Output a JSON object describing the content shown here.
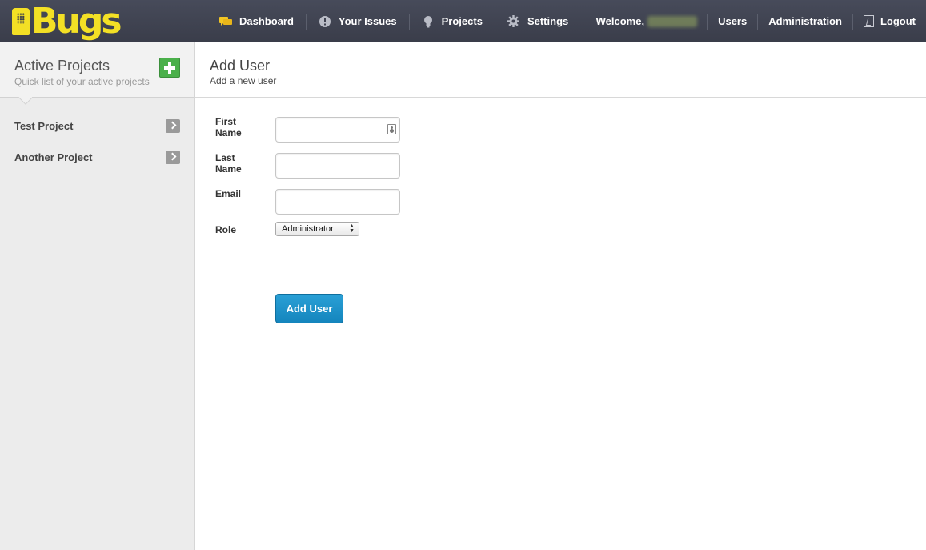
{
  "app": {
    "logo_text": "Bugs",
    "brand_color": "#f3e025"
  },
  "nav": {
    "items": [
      {
        "label": "Dashboard",
        "icon": "chat-bubble-icon"
      },
      {
        "label": "Your Issues",
        "icon": "exclamation-icon"
      },
      {
        "label": "Projects",
        "icon": "lightbulb-icon"
      },
      {
        "label": "Settings",
        "icon": "gear-icon"
      }
    ]
  },
  "user_nav": {
    "welcome": "Welcome,",
    "users": "Users",
    "administration": "Administration",
    "logout": "Logout"
  },
  "sidebar": {
    "title": "Active Projects",
    "subtitle": "Quick list of your active projects",
    "projects": [
      {
        "label": "Test Project"
      },
      {
        "label": "Another Project"
      }
    ]
  },
  "main": {
    "title": "Add User",
    "subtitle": "Add a new user"
  },
  "form": {
    "first_name_label": "First Name",
    "first_name_value": "",
    "last_name_label": "Last Name",
    "last_name_value": "",
    "email_label": "Email",
    "email_value": "",
    "role_label": "Role",
    "role_value": "Administrator",
    "submit_label": "Add User"
  },
  "colors": {
    "topbar": "#3f4250",
    "primary_button": "#1a8fc8",
    "add_button": "#4ab04a"
  }
}
